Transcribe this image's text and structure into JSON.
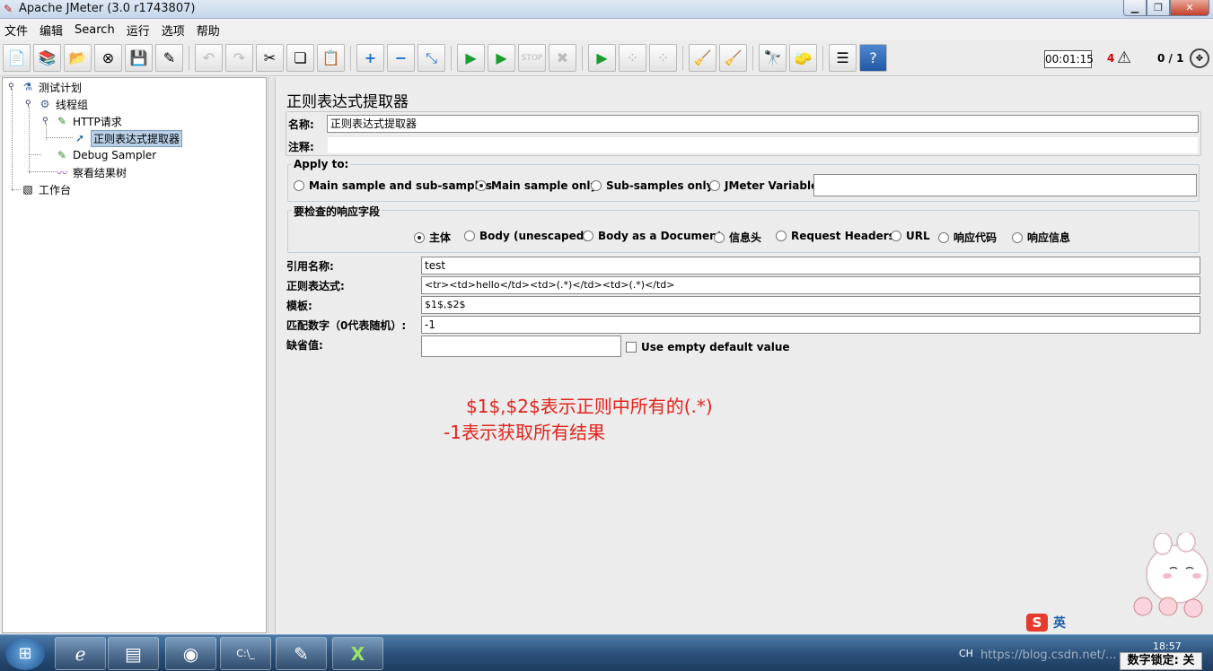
{
  "window": {
    "title": "Apache JMeter (3.0 r1743807)"
  },
  "menu": [
    "文件",
    "编辑",
    "Search",
    "运行",
    "选项",
    "帮助"
  ],
  "toolbar": {
    "timer": "00:01:15",
    "error_count": "4",
    "thread_count": "0 / 1",
    "icons": [
      "new-icon",
      "templates-icon",
      "open-icon",
      "close-icon",
      "save-icon",
      "save-as-icon",
      "undo-icon",
      "redo-icon",
      "cut-icon",
      "copy-icon",
      "paste-icon",
      "expand-icon",
      "collapse-icon",
      "toggle-icon",
      "start-icon",
      "start-no-pauses-icon",
      "stop-icon",
      "shutdown-icon",
      "remote-start-icon",
      "remote-stop-icon",
      "remote-exit-icon",
      "clear-icon",
      "clear-all-icon",
      "search-icon",
      "reset-search-icon",
      "function-helper-icon",
      "help-icon"
    ]
  },
  "tree": {
    "nodes": [
      {
        "label": "测试计划",
        "icon": "flask-icon"
      },
      {
        "label": "线程组",
        "icon": "gear-icon"
      },
      {
        "label": "HTTP请求",
        "icon": "pipette-icon"
      },
      {
        "label": "正则表达式提取器",
        "icon": "arrow-icon"
      },
      {
        "label": "Debug Sampler",
        "icon": "pipette-icon"
      },
      {
        "label": "察看结果树",
        "icon": "chart-icon"
      },
      {
        "label": "工作台",
        "icon": "workbench-icon"
      }
    ]
  },
  "panel": {
    "title": "正则表达式提取器",
    "name_label": "名称:",
    "name_value": "正则表达式提取器",
    "comment_label": "注释:",
    "comment_value": "",
    "apply_to": {
      "title": "Apply to:",
      "options": [
        "Main sample and sub-samples",
        "Main sample only",
        "Sub-samples only",
        "JMeter Variable"
      ],
      "selected": "Main sample only",
      "variable_value": ""
    },
    "field_to_check": {
      "title": "要检查的响应字段",
      "options": [
        "主体",
        "Body (unescaped)",
        "Body as a Document",
        "信息头",
        "Request Headers",
        "URL",
        "响应代码",
        "响应信息"
      ],
      "selected": "主体"
    },
    "ref_name_label": "引用名称:",
    "ref_name_value": "test",
    "regex_label": "正则表达式:",
    "regex_value": "<tr><td>hello</td><td>(.*)</td><td>(.*)</td>",
    "template_label": "模板:",
    "template_value": "$1$,$2$",
    "match_no_label": "匹配数字（0代表随机）:",
    "match_no_value": "-1",
    "default_label": "缺省值:",
    "default_value": "",
    "use_empty_label": "Use empty default value"
  },
  "annotations": {
    "line1": "$1$,$2$表示正则中所有的(.*)",
    "line2": "-1表示获取所有结果"
  },
  "taskbar": {
    "tray_lang": "CH",
    "watermark": "https://blog.csdn.net/...",
    "clock": "18:57",
    "numlock": "数字锁定: 关",
    "ime_label": "英"
  }
}
